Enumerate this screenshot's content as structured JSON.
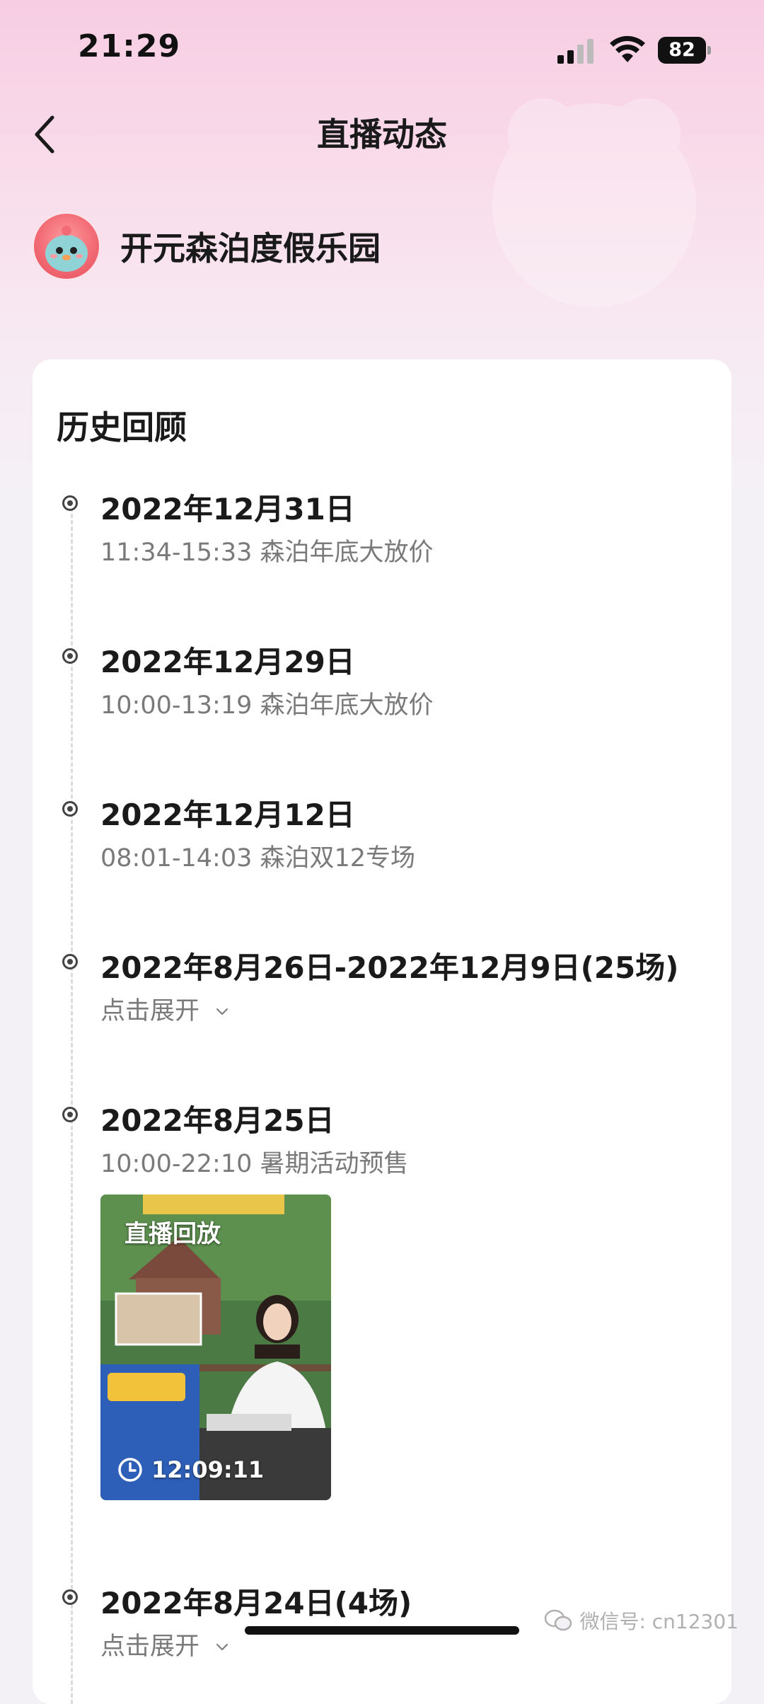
{
  "status_bar": {
    "time": "21:29",
    "battery": "82"
  },
  "nav": {
    "title": "直播动态"
  },
  "account": {
    "name": "开元森泊度假乐园"
  },
  "history": {
    "title": "历史回顾",
    "items": [
      {
        "date": "2022年12月31日",
        "detail": "11:34-15:33 森泊年底大放价"
      },
      {
        "date": "2022年12月29日",
        "detail": "10:00-13:19 森泊年底大放价"
      },
      {
        "date": "2022年12月12日",
        "detail": "08:01-14:03 森泊双12专场"
      },
      {
        "date": "2022年8月26日-2022年12月9日(25场)",
        "detail": "点击展开"
      },
      {
        "date": "2022年8月25日",
        "detail": "10:00-22:10 暑期活动预售"
      },
      {
        "date": "2022年8月24日(4场)",
        "detail": "点击展开"
      }
    ],
    "replay": {
      "label": "直播回放",
      "duration": "12:09:11"
    }
  },
  "watermark": {
    "text": "微信号: cn12301"
  },
  "colors": {
    "accent_pink": "#f7cde3",
    "text_primary": "#1a1a1a",
    "text_secondary": "#7a7a7a"
  }
}
